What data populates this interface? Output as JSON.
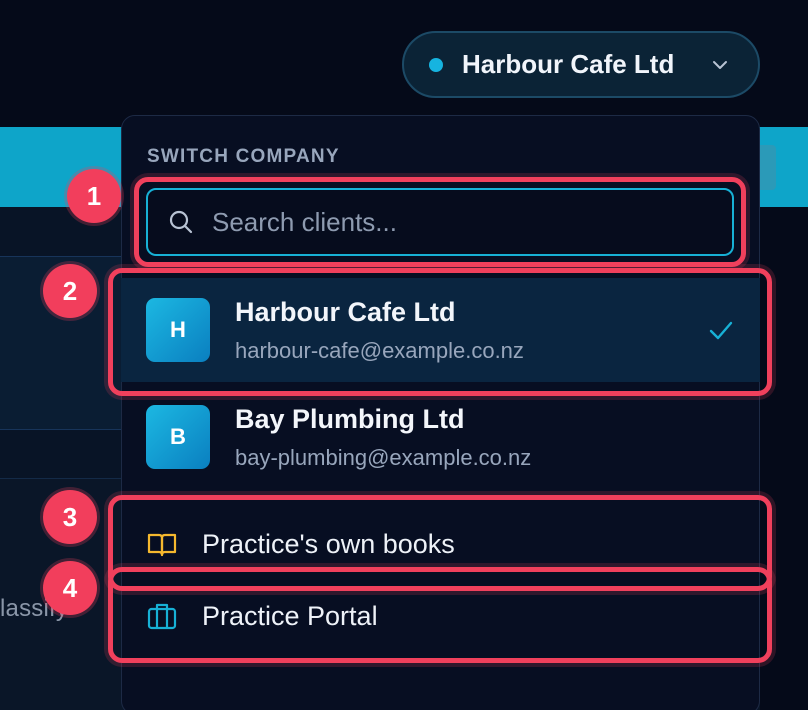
{
  "header": {
    "company_switcher": {
      "label": "Harbour Cafe Ltd",
      "status_color": "#16b4e0",
      "chevron_icon": "chevron-down-icon"
    }
  },
  "background": {
    "partial_text": "lassify"
  },
  "dropdown": {
    "section_title": "SWITCH COMPANY",
    "search": {
      "placeholder": "Search clients...",
      "value": "",
      "icon": "search-icon"
    },
    "clients": [
      {
        "initial": "H",
        "name": "Harbour Cafe Ltd",
        "email": "harbour-cafe@example.co.nz",
        "selected": true
      },
      {
        "initial": "B",
        "name": "Bay Plumbing Ltd",
        "email": "bay-plumbing@example.co.nz",
        "selected": false
      }
    ],
    "actions": [
      {
        "label": "Practice's own books",
        "icon": "book-icon",
        "icon_color": "#f5b82e"
      },
      {
        "label": "Practice Portal",
        "icon": "briefcase-icon",
        "icon_color": "#17b1d6"
      }
    ]
  },
  "annotations": {
    "badges": [
      "1",
      "2",
      "3",
      "4"
    ],
    "color": "#f23e5c"
  }
}
